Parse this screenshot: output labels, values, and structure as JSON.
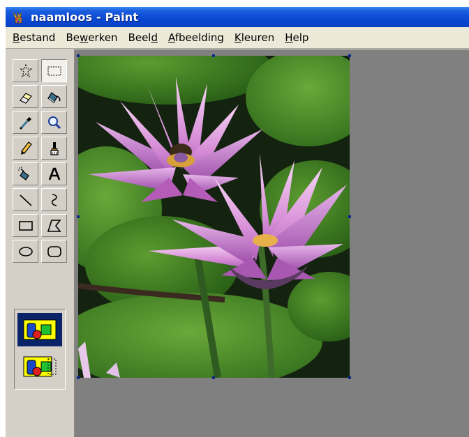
{
  "window": {
    "title": "naamloos - Paint",
    "icon": "paint-app-icon"
  },
  "menu": {
    "items": [
      {
        "pre": "",
        "key": "B",
        "post": "estand"
      },
      {
        "pre": "Be",
        "key": "w",
        "post": "erken"
      },
      {
        "pre": "Beel",
        "key": "d",
        "post": ""
      },
      {
        "pre": "",
        "key": "A",
        "post": "fbeelding"
      },
      {
        "pre": "",
        "key": "K",
        "post": "leuren"
      },
      {
        "pre": "",
        "key": "H",
        "post": "elp"
      }
    ]
  },
  "toolbox": {
    "tools": [
      {
        "name": "free-form-select",
        "icon": "star-lasso-icon",
        "selected": false
      },
      {
        "name": "select",
        "icon": "rect-select-icon",
        "selected": true
      },
      {
        "name": "eraser",
        "icon": "eraser-icon",
        "selected": false
      },
      {
        "name": "fill",
        "icon": "paint-bucket-icon",
        "selected": false
      },
      {
        "name": "pick-color",
        "icon": "eyedropper-icon",
        "selected": false
      },
      {
        "name": "magnifier",
        "icon": "magnifier-icon",
        "selected": false
      },
      {
        "name": "pencil",
        "icon": "pencil-icon",
        "selected": false
      },
      {
        "name": "brush",
        "icon": "brush-icon",
        "selected": false
      },
      {
        "name": "airbrush",
        "icon": "airbrush-icon",
        "selected": false
      },
      {
        "name": "text",
        "icon": "text-icon",
        "selected": false
      },
      {
        "name": "line",
        "icon": "line-icon",
        "selected": false
      },
      {
        "name": "curve",
        "icon": "curve-icon",
        "selected": false
      },
      {
        "name": "rectangle",
        "icon": "rectangle-icon",
        "selected": false
      },
      {
        "name": "polygon",
        "icon": "polygon-icon",
        "selected": false
      },
      {
        "name": "ellipse",
        "icon": "ellipse-icon",
        "selected": false
      },
      {
        "name": "rounded-rectangle",
        "icon": "rounded-rectangle-icon",
        "selected": false
      }
    ],
    "options": [
      {
        "name": "opaque-selection",
        "icon": "opaque-selection-icon",
        "active": true
      },
      {
        "name": "transparent-selection",
        "icon": "transparent-selection-icon",
        "active": false
      }
    ]
  },
  "colors": {
    "title_bar": "#0a47d2",
    "workspace": "#808080",
    "chrome": "#d4d0c8",
    "selection_handle": "#0a2a8c"
  }
}
